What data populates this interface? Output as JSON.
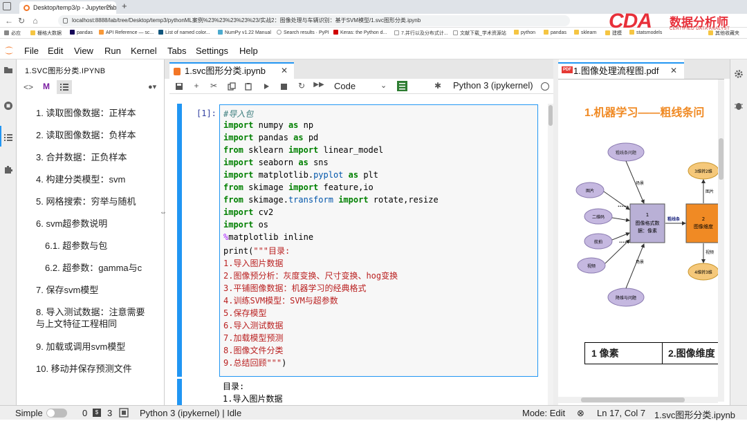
{
  "browser": {
    "tab_title": "Desktop/temp3/p - JupyterLab",
    "url": "localhost:8888/lab/tree/Desktop/temp3/pythonML案例%23%23%23%23%23/实战2：图像处理与车辆识别：基于SVM模型/1.svc图形分类.ipynb",
    "bookmarks": [
      "必应",
      "栅格大数据",
      "pandas",
      "API Reference — sc...",
      "List of named color...",
      "NumPy v1.22 Manual",
      "Search results · PyPI",
      "Keras: the Python d...",
      "7.并行以及分布式计...",
      "文献下载_学术资源站",
      "python",
      "pandas",
      "sklearn",
      "建模",
      "statsmodels",
      "其他收藏夹"
    ]
  },
  "logo": {
    "big": "CDA",
    "cn": "数据分析师",
    "en": "CERTIFIED DATA ANALYST"
  },
  "menubar": {
    "items": [
      "File",
      "Edit",
      "View",
      "Run",
      "Kernel",
      "Tabs",
      "Settings",
      "Help"
    ]
  },
  "toc": {
    "title": "1.SVC图形分类.IPYNB",
    "items": [
      "1. 读取图像数据：正样本",
      "2. 读取图像数据：负样本",
      "3. 合并数据：正负样本",
      "4. 构建分类模型：svm",
      "5. 网格搜索：穷举与随机",
      "6. svm超参数说明",
      "6.1. 超参数与包",
      "6.2. 超参数：gamma与c",
      "7. 保存svm模型",
      "8. 导入测试数据：注意需要与上文特征工程相同",
      "9. 加载或调用svm模型",
      "10. 移动并保存预测文件"
    ]
  },
  "notebook": {
    "tab_label": "1.svc图形分类.ipynb",
    "cell_type": "Code",
    "kernel_name": "Python 3 (ipykernel)",
    "prompt": "[1]:",
    "code": {
      "l1": "#导入包",
      "l2": [
        "import",
        " numpy ",
        "as",
        " np"
      ],
      "l3": [
        "import",
        " pandas ",
        "as",
        " pd"
      ],
      "l4": [
        "from",
        " sklearn ",
        "import",
        " linear_model"
      ],
      "l5": [
        "import",
        " seaborn ",
        "as",
        " sns"
      ],
      "l6": [
        "import",
        " matplotlib.",
        "pyplot",
        " ",
        "as",
        " plt"
      ],
      "l7": [
        "from",
        " skimage ",
        "import",
        " feature,io"
      ],
      "l8": [
        "from",
        " skimage.",
        "transform",
        " ",
        "import",
        " rotate,resize"
      ],
      "l9": [
        "import",
        " cv2"
      ],
      "l10": [
        "import",
        " os"
      ],
      "l11": [
        "%",
        "matplotlib inline"
      ],
      "l12": [
        "print(",
        "\"\"\"目录:"
      ],
      "l13": "1.导入图片数据",
      "l14": "2.图像预分析：灰度变换、尺寸变换、hog变换",
      "l15": "3.平铺图像数据：机器学习的经典格式",
      "l16": "4.训练SVM模型：SVM与超参数",
      "l17": "5.保存模型",
      "l18": "6.导入测试数据",
      "l19": "7.加载模型预测",
      "l20": "8.图像文件分类",
      "l21": [
        "9.总结回顾\"\"\"",
        ")"
      ]
    },
    "output": [
      "目录:",
      "1.导入图片数据"
    ]
  },
  "pdf": {
    "tab_label": "1.图像处理流程图.pdf",
    "heading": "1.机器学习——粗线条问",
    "diagram": {
      "top": "粗线条问题",
      "inputs": [
        "图片",
        "二维码",
        "航拍",
        "视频"
      ],
      "bottom": "降维与问题",
      "center": [
        "1",
        "图像格式数",
        "据：像素"
      ],
      "edge_top": "场景",
      "edge_mid": "粗线条",
      "edge_bottom": "场景",
      "right": [
        "2",
        "图像维度"
      ],
      "r_top": "3维转2维",
      "r_bottom": "4维转3维",
      "r_top_edge": "图片",
      "r_bottom_edge": "视频",
      "dots": "......"
    },
    "table": [
      "1 像素",
      "2.图像维度"
    ]
  },
  "status": {
    "mode_label": "Simple",
    "count0": "0",
    "count3": "3",
    "kernel": "Python 3 (ipykernel) | Idle",
    "mode": "Mode: Edit",
    "position": "Ln 17, Col 7",
    "filename": "1.svc图形分类.ipynb"
  },
  "colors": {
    "accent": "#2196f3",
    "jupyter_orange": "#f37626",
    "pdf_heading": "#f08a24",
    "logo_red": "#e8303a"
  }
}
